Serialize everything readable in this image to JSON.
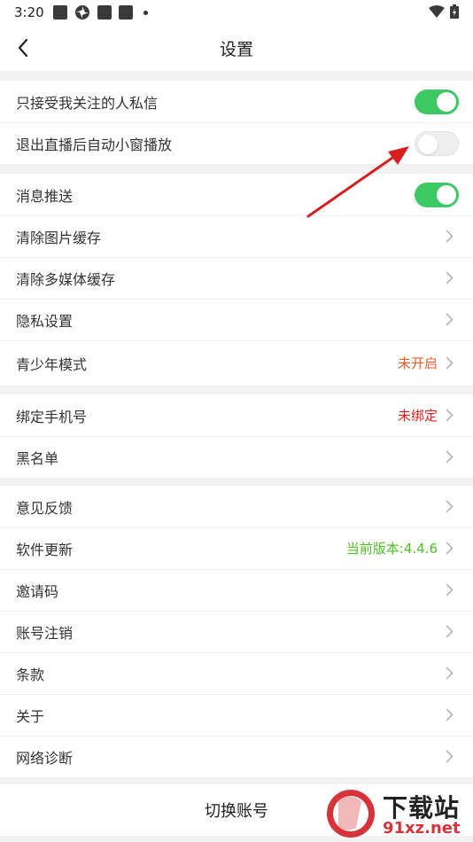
{
  "status_bar": {
    "time": "3:20",
    "icons": [
      "notification-icon",
      "pinwheel-icon",
      "notification-icon",
      "notification-icon",
      "more-dot-icon"
    ],
    "right_icons": [
      "wifi-icon",
      "battery-icon"
    ]
  },
  "nav": {
    "title": "设置",
    "back_icon": "chevron-left-icon"
  },
  "group1": [
    {
      "label": "只接受我关注的人私信",
      "toggle": "on"
    },
    {
      "label": "退出直播后自动小窗播放",
      "toggle": "off"
    }
  ],
  "group2": [
    {
      "label": "消息推送",
      "toggle": "on"
    },
    {
      "label": "清除图片缓存"
    },
    {
      "label": "清除多媒体缓存"
    },
    {
      "label": "隐私设置"
    },
    {
      "label": "青少年模式",
      "value": "未开启",
      "value_color": "#ef5b28"
    }
  ],
  "group3": [
    {
      "label": "绑定手机号",
      "value": "未绑定",
      "value_color": "#e61e1e"
    },
    {
      "label": "黑名单"
    }
  ],
  "group4": [
    {
      "label": "意见反馈"
    },
    {
      "label": "软件更新",
      "value": "当前版本:4.4.6",
      "value_color": "#4cc21f"
    },
    {
      "label": "邀请码"
    },
    {
      "label": "账号注销"
    },
    {
      "label": "条款"
    },
    {
      "label": "关于"
    },
    {
      "label": "网络诊断"
    }
  ],
  "switch_account": "切换账号",
  "watermark": {
    "logo_text": "91",
    "name": "下载站",
    "domain": "91xz.net"
  },
  "colors": {
    "toggle_on": "#3cc964",
    "toggle_off": "#eeeeee",
    "annotation_arrow": "#d81e1e"
  }
}
